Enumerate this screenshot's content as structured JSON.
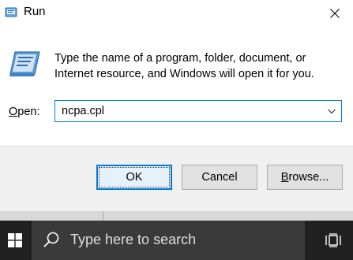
{
  "window": {
    "title": "Run",
    "close_icon": "close-icon"
  },
  "dialog": {
    "description": "Type the name of a program, folder, document, or Internet resource, and Windows will open it for you.",
    "open_label_prefix": "",
    "open_label_accel": "O",
    "open_label_rest": "pen:",
    "open_value": "ncpa.cpl"
  },
  "buttons": {
    "ok": "OK",
    "cancel": "Cancel",
    "browse_accel": "B",
    "browse_rest": "rowse..."
  },
  "taskbar": {
    "search_placeholder": "Type here to search"
  },
  "colors": {
    "accent": "#0078d7",
    "taskbar": "#202020",
    "search_box": "#3a3a3a",
    "footer": "#f0f0f0"
  }
}
